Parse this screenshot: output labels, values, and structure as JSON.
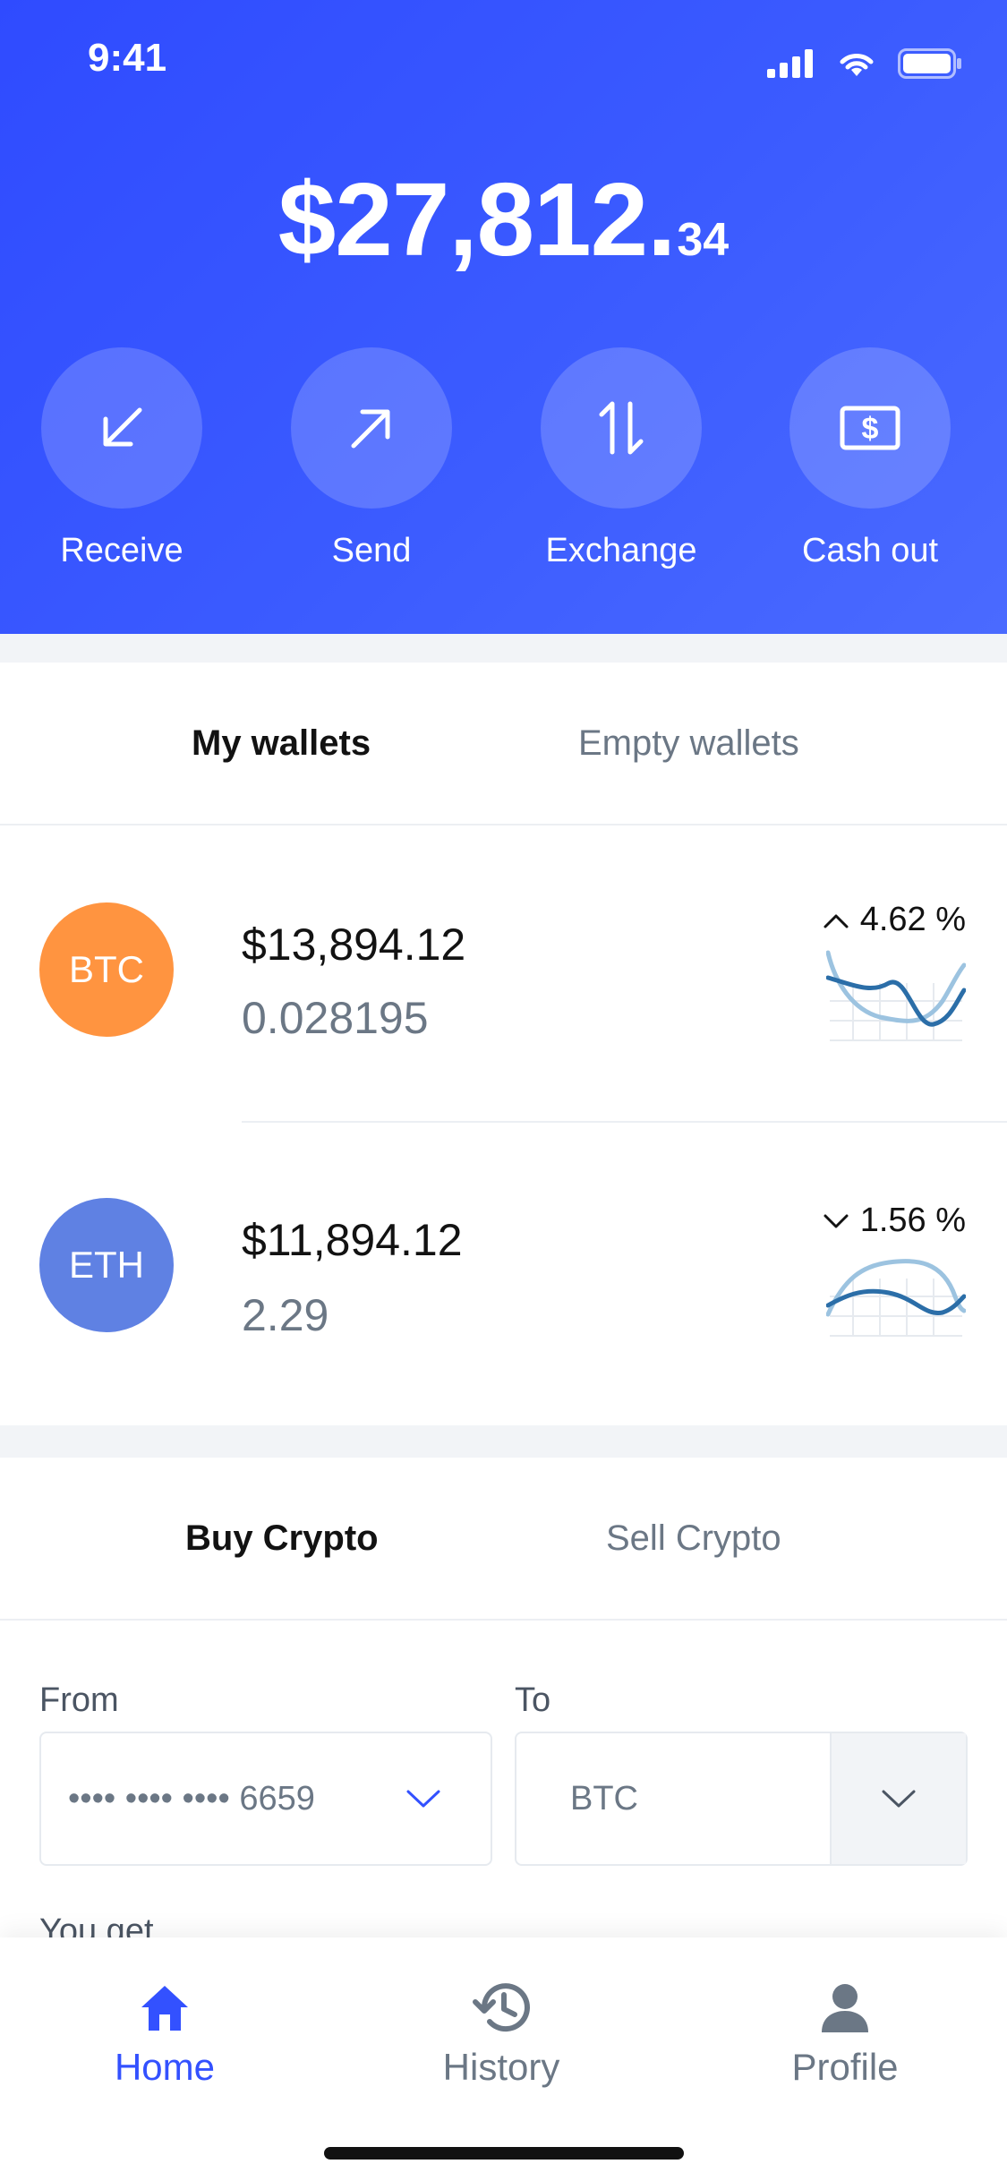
{
  "status": {
    "time": "9:41"
  },
  "balance": {
    "main": "$27,812.",
    "cents": "34"
  },
  "actions": [
    {
      "label": "Receive",
      "icon": "receive-arrow-icon"
    },
    {
      "label": "Send",
      "icon": "send-arrow-icon"
    },
    {
      "label": "Exchange",
      "icon": "exchange-icon"
    },
    {
      "label": "Cash out",
      "icon": "cash-icon"
    }
  ],
  "wallet_tabs": {
    "active": "My wallets",
    "inactive": "Empty wallets"
  },
  "wallets": [
    {
      "symbol": "BTC",
      "amount": "$13,894.12",
      "qty": "0.028195",
      "change": "4.62 %",
      "direction": "up",
      "color": "#ff9440"
    },
    {
      "symbol": "ETH",
      "amount": "$11,894.12",
      "qty": "2.29",
      "change": "1.56 %",
      "direction": "down",
      "color": "#5f81e3"
    }
  ],
  "trade_tabs": {
    "active": "Buy Crypto",
    "inactive": "Sell Crypto"
  },
  "form": {
    "from_label": "From",
    "from_value": "•••• •••• •••• 6659",
    "to_label": "To",
    "to_value": "BTC",
    "you_get_label": "You get"
  },
  "nav": {
    "home": "Home",
    "history": "History",
    "profile": "Profile"
  },
  "colors": {
    "accent": "#3351ff",
    "muted": "#6b7785",
    "btc": "#ff9440",
    "eth": "#5f81e3"
  }
}
